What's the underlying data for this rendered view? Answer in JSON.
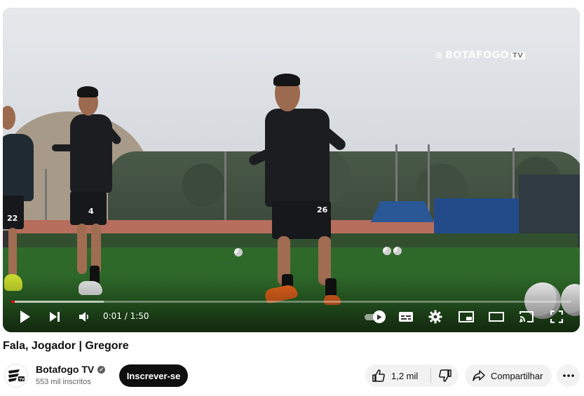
{
  "player": {
    "watermark_text": "BOTAFOGO",
    "watermark_tv": "TV",
    "time_display": "0:01 / 1:50",
    "progress_played_fraction": 0.006,
    "progress_loaded_fraction": 0.165,
    "kit_numbers": [
      "22",
      "4",
      "26"
    ],
    "controls": {
      "play_icon": "play-icon",
      "next_icon": "next-icon",
      "volume_icon": "volume-icon",
      "autoplay_icon": "autoplay-toggle-icon",
      "captions_icon": "captions-icon",
      "settings_icon": "gear-icon",
      "miniplayer_icon": "miniplayer-icon",
      "theater_icon": "theater-mode-icon",
      "cast_icon": "cast-icon",
      "fullscreen_icon": "fullscreen-icon"
    },
    "accent_color": "#ff0000"
  },
  "video": {
    "title": "Fala, Jogador | Gregore"
  },
  "channel": {
    "name": "Botafogo TV",
    "subscribers": "553 mil inscritos",
    "subscribe_label": "Inscrever-se"
  },
  "actions": {
    "like_count": "1,2 mil",
    "share_label": "Compartilhar",
    "like_icon": "thumbs-up-icon",
    "dislike_icon": "thumbs-down-icon",
    "share_icon": "share-icon",
    "more_icon": "more-options-icon"
  }
}
